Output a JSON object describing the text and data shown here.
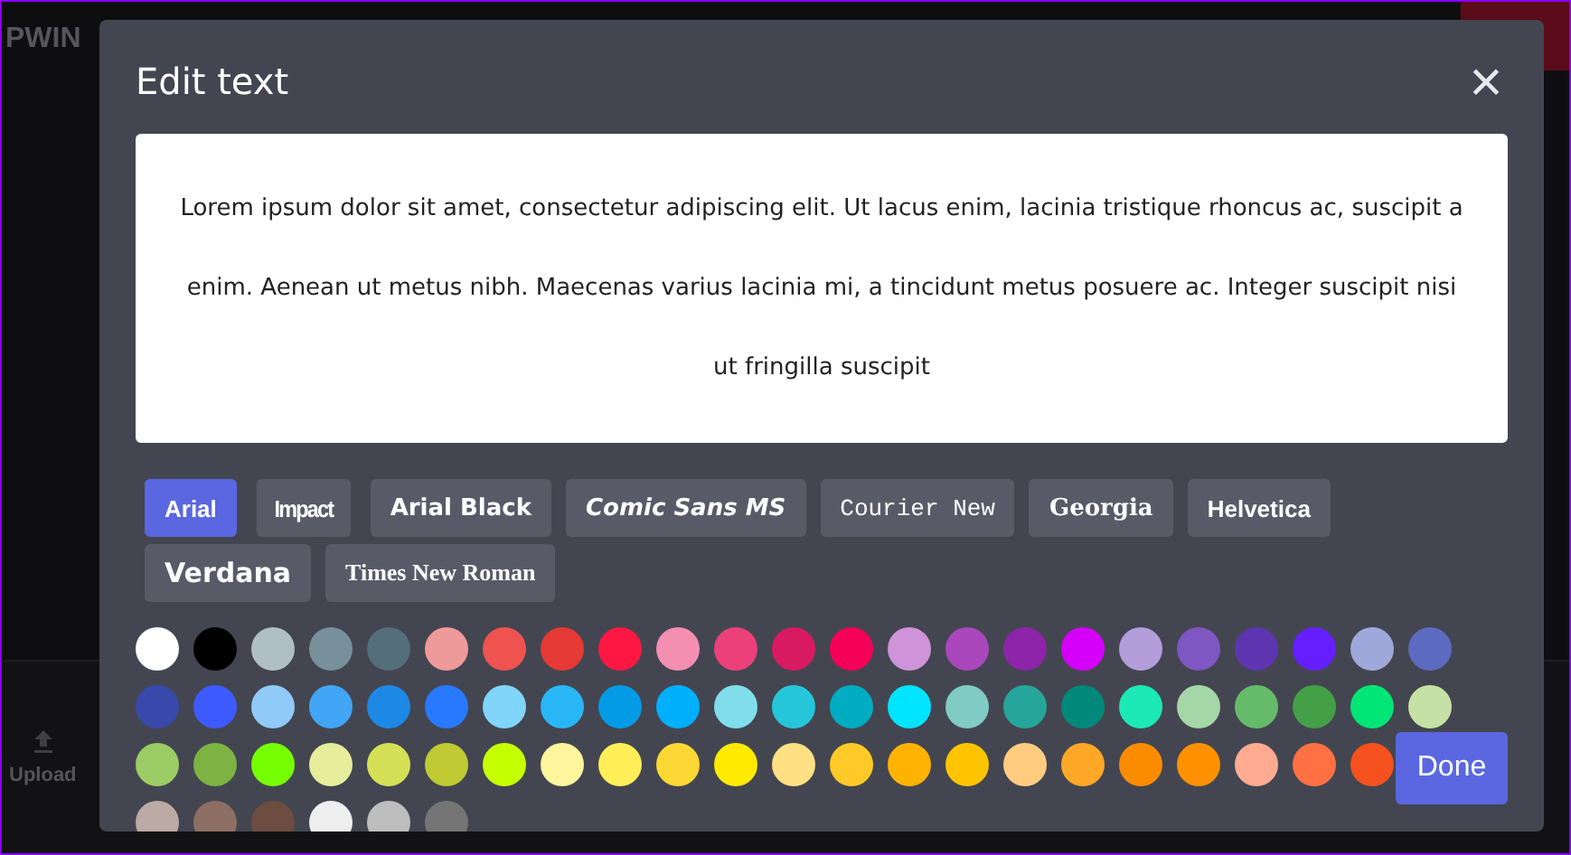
{
  "background": {
    "logo": "PWIN",
    "toolbar": [
      {
        "label": "Upload",
        "kind": "upload"
      }
    ]
  },
  "dialog": {
    "title": "Edit text",
    "close": "×",
    "text": "Lorem ipsum dolor sit amet, consectetur adipiscing elit. Ut lacus enim, lacinia tristique rhoncus ac, suscipit a enim. Aenean ut metus nibh. Maecenas varius lacinia mi, a tincidunt metus posuere ac. Integer suscipit nisi ut fringilla suscipit",
    "fonts": [
      {
        "label": "Arial",
        "kind": "sans",
        "selected": true
      },
      {
        "label": "Impact",
        "kind": "impact",
        "selected": false
      },
      {
        "label": "Arial Black",
        "kind": "black",
        "selected": false
      },
      {
        "label": "Comic Sans MS",
        "kind": "comic",
        "selected": false
      },
      {
        "label": "Courier New",
        "kind": "mono",
        "selected": false
      },
      {
        "label": "Georgia",
        "kind": "serifbold",
        "selected": false
      },
      {
        "label": "Helvetica",
        "kind": "sans",
        "selected": false
      },
      {
        "label": "Verdana",
        "kind": "wide",
        "selected": false
      },
      {
        "label": "Times New Roman",
        "kind": "serif",
        "selected": false
      }
    ],
    "colors": [
      {
        "color": "#ffffff"
      },
      {
        "color": "#000000"
      },
      {
        "color": "#b0bec5"
      },
      {
        "color": "#78909c"
      },
      {
        "color": "#546e7a"
      },
      {
        "color": "#ef9a9a"
      },
      {
        "color": "#ef5350"
      },
      {
        "color": "#e53935"
      },
      {
        "color": "#ff1744"
      },
      {
        "color": "#f48fb1"
      },
      {
        "color": "#ec407a"
      },
      {
        "color": "#d81b60"
      },
      {
        "color": "#f50057"
      },
      {
        "color": "#ce93d8"
      },
      {
        "color": "#ab47bc"
      },
      {
        "color": "#8e24aa"
      },
      {
        "color": "#d500f9"
      },
      {
        "color": "#b39ddb"
      },
      {
        "color": "#7e57c2"
      },
      {
        "color": "#5e35b1"
      },
      {
        "color": "#651fff"
      },
      {
        "color": "#9fa8da"
      },
      {
        "color": "#5c6bc0"
      },
      {
        "color": "#3949ab"
      },
      {
        "color": "#3d5afe"
      },
      {
        "color": "#90caf9"
      },
      {
        "color": "#42a5f5"
      },
      {
        "color": "#1e88e5"
      },
      {
        "color": "#2979ff"
      },
      {
        "color": "#81d4fa"
      },
      {
        "color": "#29b6f6"
      },
      {
        "color": "#039be5"
      },
      {
        "color": "#00b0ff"
      },
      {
        "color": "#80deea"
      },
      {
        "color": "#26c6da"
      },
      {
        "color": "#00acc1"
      },
      {
        "color": "#00e5ff"
      },
      {
        "color": "#80cbc4"
      },
      {
        "color": "#26a69a"
      },
      {
        "color": "#00897b"
      },
      {
        "color": "#1de9b6"
      },
      {
        "color": "#a5d6a7"
      },
      {
        "color": "#66bb6a"
      },
      {
        "color": "#43a047"
      },
      {
        "color": "#00e676"
      },
      {
        "color": "#c5e1a5"
      },
      {
        "color": "#9ccc65"
      },
      {
        "color": "#7cb342"
      },
      {
        "color": "#76ff03"
      },
      {
        "color": "#e6ee9c"
      },
      {
        "color": "#d4e157"
      },
      {
        "color": "#c0ca33"
      },
      {
        "color": "#c6ff00"
      },
      {
        "color": "#fff59d"
      },
      {
        "color": "#ffee58"
      },
      {
        "color": "#fdd835"
      },
      {
        "color": "#ffea00"
      },
      {
        "color": "#ffe082"
      },
      {
        "color": "#ffca28"
      },
      {
        "color": "#ffb300"
      },
      {
        "color": "#ffc400"
      },
      {
        "color": "#ffcc80"
      },
      {
        "color": "#ffa726"
      },
      {
        "color": "#fb8c00"
      },
      {
        "color": "#ff9100"
      },
      {
        "color": "#ffab91"
      },
      {
        "color": "#ff7043"
      },
      {
        "color": "#f4511e"
      },
      {
        "color": "#bcaaa4"
      },
      {
        "color": "#8d6e63"
      },
      {
        "color": "#6d4c41"
      },
      {
        "color": "#eeeeee"
      },
      {
        "color": "#bdbdbd"
      },
      {
        "color": "#757575"
      }
    ],
    "done": "Done"
  }
}
